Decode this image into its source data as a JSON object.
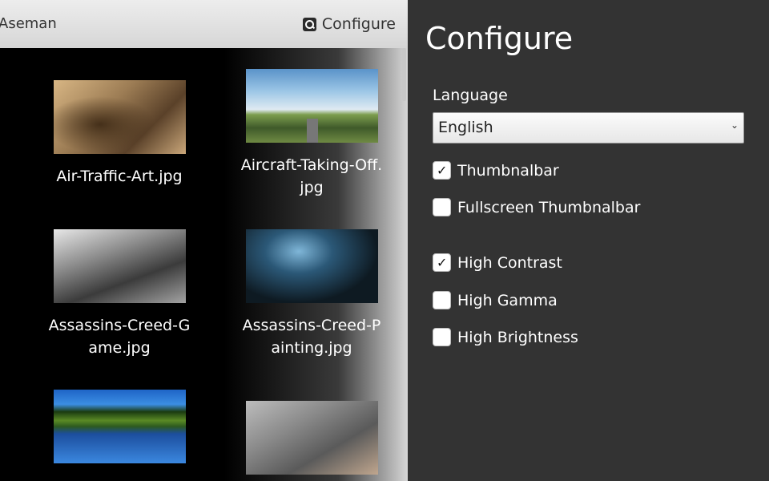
{
  "app": {
    "title": "Aseman"
  },
  "toolbar": {
    "configure_label": "Configure"
  },
  "gallery": {
    "items": [
      {
        "label": "Air-Traffic-Art.jpg",
        "image": "steampunk-airship-scene"
      },
      {
        "label": "Aircraft-Taking-Off.jpg",
        "image": "airplane-over-runway"
      },
      {
        "label": "Assassins-Creed-Game.jpg",
        "image": "ruined-interior-scene"
      },
      {
        "label": "Assassins-Creed-Painting.jpg",
        "image": "dark-cave-figure"
      },
      {
        "label": "",
        "image": "lake-with-trees"
      },
      {
        "label": "",
        "image": "giant-wheel-machine"
      }
    ]
  },
  "configure": {
    "title": "Configure",
    "language_label": "Language",
    "language_value": "English",
    "options": [
      {
        "label": "Thumbnalbar",
        "checked": true
      },
      {
        "label": "Fullscreen Thumbnalbar",
        "checked": false
      },
      {
        "label": "High Contrast",
        "checked": true
      },
      {
        "label": "High Gamma",
        "checked": false
      },
      {
        "label": "High Brightness",
        "checked": false
      }
    ]
  },
  "colors": {
    "panel_bg": "#333333",
    "accent_text": "#ffffff"
  }
}
